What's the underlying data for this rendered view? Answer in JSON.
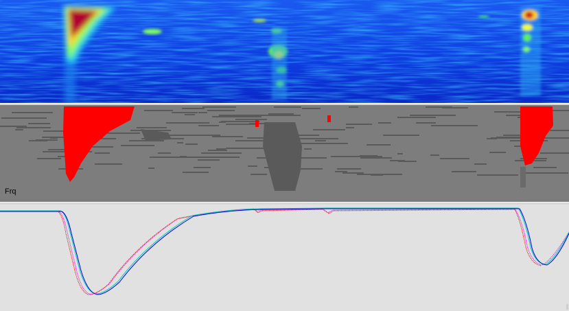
{
  "panes": {
    "spectrogram": {
      "name": "spectrogram"
    },
    "threshold": {
      "label": "Frq"
    },
    "trace": {
      "name": "trace"
    }
  },
  "colors": {
    "spectrogram_bg": "#0a2fd0",
    "spectrogram_hot": "#b00030",
    "threshold_bg": "#7d7d7d",
    "threshold_dark": "#5a5a5a",
    "threshold_hit": "#ff0000",
    "trace_bg": "#e1e1e1",
    "trace_blue": "#0000c8",
    "trace_cyan": "#00c8c8",
    "trace_red": "#e00000",
    "trace_magenta": "#e000e0"
  }
}
